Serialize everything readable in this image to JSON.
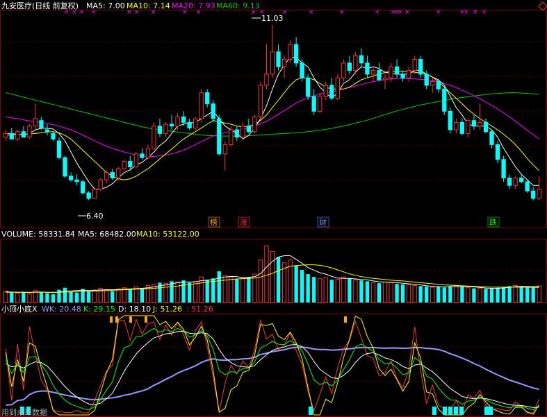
{
  "chart_data": [
    {
      "type": "candlestick",
      "title": "九安医疗(日线 前复权)",
      "legend": [
        {
          "name": "MA5",
          "value": "7.00",
          "color": "#ffffff"
        },
        {
          "name": "MA10",
          "value": "7.14",
          "color": "#ffff00"
        },
        {
          "name": "MA20",
          "value": "7.93",
          "color": "#ff00ff"
        },
        {
          "name": "MA60",
          "value": "9.13",
          "color": "#00cc00"
        }
      ],
      "annotations": {
        "high": "11.03",
        "low": "6.40"
      },
      "event_markers": [
        {
          "label": "榜",
          "color": "#ffaa00"
        },
        {
          "label": "涨",
          "color": "#ff3333"
        },
        {
          "label": "财",
          "color": "#6699ff"
        },
        {
          "label": "跌",
          "color": "#00ff00"
        }
      ],
      "ylim": [
        5.9,
        11.4
      ],
      "candles": [
        [
          8.0,
          8.2,
          7.9,
          8.1
        ],
        [
          8.1,
          8.25,
          7.95,
          7.95
        ],
        [
          7.95,
          8.2,
          7.9,
          8.15
        ],
        [
          8.15,
          8.3,
          8.0,
          8.0
        ],
        [
          8.0,
          8.35,
          7.95,
          8.3
        ],
        [
          8.3,
          8.9,
          8.2,
          8.5
        ],
        [
          8.45,
          8.55,
          8.2,
          8.25
        ],
        [
          8.2,
          8.35,
          8.05,
          8.15
        ],
        [
          8.1,
          8.15,
          7.9,
          7.95
        ],
        [
          7.9,
          8.0,
          7.4,
          7.45
        ],
        [
          7.45,
          7.5,
          6.9,
          6.95
        ],
        [
          6.95,
          7.05,
          6.8,
          6.85
        ],
        [
          6.85,
          7.0,
          6.7,
          6.8
        ],
        [
          6.8,
          6.85,
          6.45,
          6.5
        ],
        [
          6.5,
          6.55,
          6.3,
          6.35
        ],
        [
          6.35,
          6.65,
          6.35,
          6.6
        ],
        [
          6.6,
          6.9,
          6.55,
          6.85
        ],
        [
          6.85,
          7.1,
          6.75,
          7.05
        ],
        [
          7.05,
          7.15,
          6.85,
          6.9
        ],
        [
          6.9,
          7.2,
          6.85,
          7.15
        ],
        [
          7.15,
          7.4,
          7.1,
          7.35
        ],
        [
          7.35,
          7.5,
          7.1,
          7.2
        ],
        [
          7.2,
          7.6,
          7.15,
          7.55
        ],
        [
          7.55,
          7.7,
          7.4,
          7.45
        ],
        [
          7.45,
          7.8,
          7.4,
          7.7
        ],
        [
          7.7,
          8.4,
          7.65,
          8.3
        ],
        [
          8.3,
          8.5,
          8.0,
          8.1
        ],
        [
          8.1,
          8.4,
          8.0,
          8.35
        ],
        [
          8.35,
          8.6,
          8.2,
          8.3
        ],
        [
          8.3,
          8.65,
          8.2,
          8.55
        ],
        [
          8.55,
          8.7,
          8.3,
          8.4
        ],
        [
          8.4,
          8.5,
          8.2,
          8.25
        ],
        [
          8.25,
          8.55,
          8.2,
          8.5
        ],
        [
          8.5,
          9.3,
          8.4,
          9.2
        ],
        [
          9.2,
          9.3,
          8.8,
          8.9
        ],
        [
          8.9,
          9.0,
          8.4,
          8.5
        ],
        [
          8.5,
          8.6,
          7.5,
          7.55
        ],
        [
          7.55,
          7.9,
          7.1,
          7.8
        ],
        [
          7.8,
          8.3,
          7.75,
          8.2
        ],
        [
          8.2,
          8.3,
          7.9,
          8.0
        ],
        [
          8.0,
          8.4,
          7.95,
          8.3
        ],
        [
          8.3,
          8.5,
          8.1,
          8.15
        ],
        [
          8.15,
          8.6,
          8.1,
          8.55
        ],
        [
          8.55,
          9.5,
          8.5,
          9.4
        ],
        [
          9.4,
          10.5,
          9.3,
          9.7
        ],
        [
          9.7,
          11.03,
          9.6,
          10.3
        ],
        [
          10.3,
          10.5,
          9.8,
          9.9
        ],
        [
          9.9,
          10.2,
          9.6,
          10.1
        ],
        [
          10.1,
          10.6,
          10.0,
          10.5
        ],
        [
          10.5,
          10.7,
          9.9,
          10.0
        ],
        [
          10.0,
          10.1,
          9.5,
          9.6
        ],
        [
          9.6,
          9.7,
          9.0,
          9.1
        ],
        [
          9.1,
          9.3,
          8.6,
          8.7
        ],
        [
          8.7,
          9.2,
          8.65,
          9.1
        ],
        [
          9.1,
          9.5,
          9.0,
          9.4
        ],
        [
          9.4,
          9.6,
          9.0,
          9.05
        ],
        [
          9.05,
          9.7,
          9.0,
          9.6
        ],
        [
          9.6,
          10.1,
          9.5,
          10.0
        ],
        [
          10.0,
          10.2,
          9.7,
          9.8
        ],
        [
          9.8,
          10.3,
          9.7,
          10.2
        ],
        [
          10.2,
          10.4,
          9.9,
          10.0
        ],
        [
          10.0,
          10.2,
          9.6,
          9.7
        ],
        [
          9.7,
          9.9,
          9.5,
          9.8
        ],
        [
          9.8,
          10.0,
          9.5,
          9.55
        ],
        [
          9.55,
          9.8,
          9.3,
          9.6
        ],
        [
          9.6,
          10.0,
          9.5,
          9.9
        ],
        [
          9.9,
          10.1,
          9.6,
          9.7
        ],
        [
          9.7,
          9.8,
          9.5,
          9.6
        ],
        [
          9.6,
          9.9,
          9.5,
          9.8
        ],
        [
          9.8,
          10.2,
          9.7,
          10.1
        ],
        [
          10.1,
          10.2,
          9.6,
          9.7
        ],
        [
          9.7,
          9.8,
          9.3,
          9.4
        ],
        [
          9.4,
          9.6,
          9.2,
          9.5
        ],
        [
          9.5,
          9.55,
          9.2,
          9.3
        ],
        [
          9.3,
          9.4,
          8.6,
          8.7
        ],
        [
          8.7,
          8.8,
          8.1,
          8.2
        ],
        [
          8.2,
          8.5,
          8.1,
          8.4
        ],
        [
          8.4,
          8.5,
          8.05,
          8.1
        ],
        [
          8.1,
          8.5,
          8.0,
          8.45
        ],
        [
          8.45,
          8.6,
          8.2,
          8.3
        ],
        [
          8.3,
          8.9,
          8.2,
          8.4
        ],
        [
          8.4,
          8.5,
          8.1,
          8.15
        ],
        [
          8.15,
          8.2,
          7.7,
          7.8
        ],
        [
          7.8,
          7.9,
          7.3,
          7.4
        ],
        [
          7.4,
          7.5,
          6.8,
          6.9
        ],
        [
          6.9,
          7.0,
          6.6,
          6.7
        ],
        [
          6.7,
          6.95,
          6.6,
          6.9
        ],
        [
          6.9,
          7.0,
          6.75,
          6.8
        ],
        [
          6.8,
          6.85,
          6.5,
          6.55
        ],
        [
          6.55,
          6.65,
          6.3,
          6.35
        ],
        [
          6.35,
          6.95,
          6.3,
          6.6
        ]
      ],
      "ma": {
        "MA5": [
          8.1,
          8.1,
          8.08,
          8.06,
          8.1,
          8.2,
          8.24,
          8.24,
          8.22,
          8.1,
          7.9,
          7.6,
          7.3,
          7.05,
          6.8,
          6.6,
          6.6,
          6.65,
          6.75,
          6.9,
          7.05,
          7.12,
          7.25,
          7.32,
          7.45,
          7.6,
          7.78,
          7.9,
          8.1,
          8.3,
          8.35,
          8.38,
          8.4,
          8.5,
          8.6,
          8.7,
          8.5,
          8.3,
          8.2,
          8.1,
          7.95,
          8.05,
          8.25,
          8.5,
          8.85,
          9.3,
          9.7,
          9.95,
          10.15,
          10.15,
          10.0,
          9.9,
          9.6,
          9.35,
          9.2,
          9.05,
          9.2,
          9.45,
          9.55,
          9.75,
          9.9,
          9.85,
          9.9,
          9.85,
          9.75,
          9.72,
          9.7,
          9.7,
          9.7,
          9.8,
          9.8,
          9.7,
          9.62,
          9.55,
          9.4,
          9.1,
          8.8,
          8.6,
          8.35,
          8.3,
          8.3,
          8.3,
          8.2,
          8.0,
          7.7,
          7.45,
          7.2,
          7.0,
          6.85,
          6.7,
          6.7
        ],
        "MA10": [
          8.05,
          8.06,
          8.07,
          8.08,
          8.09,
          8.1,
          8.12,
          8.14,
          8.15,
          8.12,
          8.05,
          7.95,
          7.8,
          7.65,
          7.5,
          7.35,
          7.2,
          7.05,
          6.95,
          6.88,
          6.85,
          6.88,
          6.95,
          7.05,
          7.15,
          7.28,
          7.42,
          7.55,
          7.68,
          7.82,
          7.95,
          8.05,
          8.15,
          8.25,
          8.35,
          8.45,
          8.42,
          8.38,
          8.35,
          8.3,
          8.28,
          8.3,
          8.35,
          8.45,
          8.6,
          8.8,
          9.0,
          9.2,
          9.4,
          9.55,
          9.6,
          9.6,
          9.55,
          9.45,
          9.35,
          9.3,
          9.3,
          9.3,
          9.35,
          9.45,
          9.55,
          9.6,
          9.65,
          9.7,
          9.75,
          9.77,
          9.78,
          9.78,
          9.77,
          9.75,
          9.73,
          9.7,
          9.62,
          9.5,
          9.35,
          9.2,
          9.05,
          8.9,
          8.75,
          8.62,
          8.5,
          8.4,
          8.3,
          8.2,
          8.08,
          7.95,
          7.8,
          7.62,
          7.42,
          7.25,
          7.1
        ],
        "MA20": [
          8.55,
          8.52,
          8.5,
          8.47,
          8.44,
          8.42,
          8.4,
          8.37,
          8.34,
          8.3,
          8.25,
          8.2,
          8.13,
          8.06,
          7.98,
          7.9,
          7.83,
          7.76,
          7.7,
          7.65,
          7.6,
          7.56,
          7.52,
          7.5,
          7.48,
          7.48,
          7.5,
          7.52,
          7.55,
          7.6,
          7.65,
          7.72,
          7.8,
          7.88,
          7.96,
          8.03,
          8.08,
          8.12,
          8.15,
          8.18,
          8.21,
          8.25,
          8.3,
          8.36,
          8.43,
          8.52,
          8.62,
          8.72,
          8.82,
          8.92,
          9.0,
          9.07,
          9.12,
          9.16,
          9.2,
          9.23,
          9.26,
          9.3,
          9.34,
          9.38,
          9.42,
          9.46,
          9.5,
          9.53,
          9.55,
          9.57,
          9.58,
          9.58,
          9.58,
          9.57,
          9.56,
          9.55,
          9.53,
          9.5,
          9.45,
          9.4,
          9.34,
          9.27,
          9.2,
          9.12,
          9.04,
          8.95,
          8.86,
          8.76,
          8.66,
          8.55,
          8.43,
          8.31,
          8.19,
          8.07,
          7.95
        ],
        "MA60": [
          9.2,
          9.16,
          9.12,
          9.08,
          9.04,
          9.0,
          8.96,
          8.92,
          8.88,
          8.84,
          8.8,
          8.76,
          8.72,
          8.68,
          8.64,
          8.6,
          8.56,
          8.52,
          8.48,
          8.44,
          8.4,
          8.36,
          8.32,
          8.28,
          8.25,
          8.22,
          8.2,
          8.18,
          8.16,
          8.14,
          8.12,
          8.1,
          8.08,
          8.06,
          8.05,
          8.04,
          8.03,
          8.03,
          8.03,
          8.03,
          8.03,
          8.04,
          8.05,
          8.06,
          8.07,
          8.08,
          8.09,
          8.1,
          8.11,
          8.12,
          8.13,
          8.15,
          8.17,
          8.19,
          8.21,
          8.24,
          8.27,
          8.3,
          8.34,
          8.38,
          8.42,
          8.46,
          8.51,
          8.56,
          8.61,
          8.66,
          8.71,
          8.75,
          8.79,
          8.83,
          8.87,
          8.9,
          8.93,
          8.96,
          8.99,
          9.02,
          9.05,
          9.07,
          9.09,
          9.11,
          9.13,
          9.15,
          9.17,
          9.18,
          9.19,
          9.2,
          9.2,
          9.19,
          9.18,
          9.17,
          9.16
        ]
      }
    },
    {
      "type": "bar",
      "legend": [
        {
          "name": "VOLUME",
          "value": "58331.84",
          "color": "#ffffff"
        },
        {
          "name": "MA5",
          "value": "68482.00",
          "color": "#ffffff"
        },
        {
          "name": "MA10",
          "value": "53122.00",
          "color": "#ffff00"
        }
      ],
      "ylim": [
        0,
        220000
      ],
      "values": [
        40000,
        35000,
        32000,
        38000,
        30000,
        42000,
        36000,
        33000,
        29000,
        45000,
        52000,
        38000,
        35000,
        48000,
        40000,
        44000,
        50000,
        46000,
        40000,
        48000,
        52000,
        49000,
        55000,
        50000,
        60000,
        65000,
        70000,
        68000,
        75000,
        72000,
        78000,
        70000,
        74000,
        90000,
        80000,
        85000,
        110000,
        95000,
        88000,
        82000,
        86000,
        90000,
        100000,
        150000,
        200000,
        180000,
        160000,
        140000,
        150000,
        130000,
        115000,
        100000,
        90000,
        85000,
        88000,
        80000,
        82000,
        90000,
        85000,
        80000,
        78000,
        75000,
        70000,
        68000,
        72000,
        70000,
        66000,
        64000,
        62000,
        60000,
        58000,
        56000,
        54000,
        55000,
        53000,
        58000,
        60000,
        55000,
        52000,
        50000,
        49000,
        48000,
        50000,
        52000,
        55000,
        58000,
        60000,
        57000,
        55000,
        54000,
        58331
      ],
      "ma5": [
        38000,
        37000,
        36000,
        36000,
        35000,
        37000,
        37000,
        36000,
        35000,
        37000,
        40000,
        41000,
        42000,
        44000,
        42000,
        43000,
        44000,
        45000,
        45000,
        46000,
        47000,
        48000,
        49000,
        50000,
        52000,
        55000,
        59000,
        62000,
        66000,
        70000,
        72000,
        72000,
        73000,
        77000,
        79000,
        80000,
        87000,
        90000,
        92000,
        91000,
        88000,
        89000,
        91000,
        102000,
        125000,
        145000,
        160000,
        165000,
        165000,
        152000,
        138000,
        123000,
        114000,
        105000,
        100000,
        92000,
        86000,
        85000,
        85000,
        83000,
        81000,
        80000,
        76000,
        73000,
        72000,
        71000,
        70000,
        68000,
        66000,
        64000,
        62000,
        59000,
        57000,
        56000,
        55000,
        55000,
        56000,
        56000,
        56000,
        55000,
        53000,
        51000,
        50000,
        50000,
        51000,
        53000,
        56000,
        57000,
        57000,
        56000,
        56900
      ],
      "ma10": [
        36000,
        36000,
        36000,
        36000,
        36000,
        36000,
        36000,
        36000,
        36000,
        36000,
        37000,
        37000,
        38000,
        39000,
        39000,
        40000,
        41000,
        42000,
        43000,
        44000,
        45000,
        46000,
        47000,
        48000,
        49000,
        50000,
        52000,
        54000,
        56000,
        58000,
        61000,
        63000,
        66000,
        69000,
        72000,
        74000,
        77000,
        79000,
        81000,
        83000,
        84000,
        85000,
        86000,
        90000,
        96000,
        103000,
        112000,
        120000,
        128000,
        130000,
        132000,
        133000,
        133000,
        131000,
        127000,
        122000,
        115000,
        108000,
        101000,
        96000,
        91000,
        88000,
        85000,
        83000,
        81000,
        79000,
        77000,
        76000,
        74000,
        72000,
        70000,
        68000,
        66000,
        64000,
        62000,
        61000,
        60000,
        59000,
        58000,
        57000,
        56000,
        55000,
        54000,
        54000,
        54000,
        54000,
        54000,
        54000,
        53500,
        53200,
        53122
      ]
    },
    {
      "type": "line",
      "legend": [
        {
          "name": "小顶小底X",
          "value": "",
          "color": "#ffffff"
        },
        {
          "name": "WK",
          "value": "20.48",
          "color": "#9999ff"
        },
        {
          "name": "K",
          "value": "29.15",
          "color": "#00ff00"
        },
        {
          "name": "D",
          "value": "18.10",
          "color": "#ffffff"
        },
        {
          "name": "J",
          "value": "51.26",
          "color": "#ffff00"
        },
        {
          "name": "",
          "value": "51.26",
          "color": "#ff3333"
        }
      ],
      "footer": "用到未来数据",
      "ylim": [
        0,
        100
      ]
    }
  ]
}
